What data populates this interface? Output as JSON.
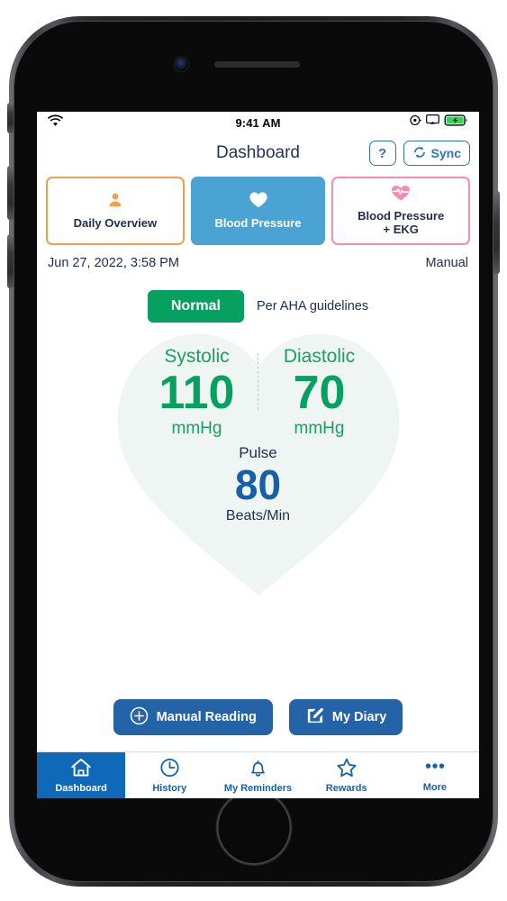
{
  "status_bar": {
    "time": "9:41 AM",
    "wifi_icon": "wifi-icon",
    "location_icon": "location-icon",
    "airplay_icon": "screen-mirroring-icon",
    "battery_icon": "battery-charging-icon"
  },
  "header": {
    "title": "Dashboard",
    "help_label": "?",
    "sync_label": "Sync"
  },
  "tabs": [
    {
      "id": "daily-overview",
      "label": "Daily Overview",
      "icon": "person-icon",
      "color": "#f0a04b",
      "active": false
    },
    {
      "id": "blood-pressure",
      "label": "Blood Pressure",
      "icon": "heart-icon",
      "color": "#4ba3d3",
      "active": true
    },
    {
      "id": "bp-ekg",
      "label": "Blood Pressure\n+ EKG",
      "label_line1": "Blood Pressure",
      "label_line2": "+ EKG",
      "icon": "heart-ekg-icon",
      "color": "#f28cb4",
      "active": false
    }
  ],
  "reading": {
    "datetime": "Jun 27, 2022, 3:58 PM",
    "source": "Manual",
    "status_badge": "Normal",
    "status_color": "#06a160",
    "guideline_note": "Per AHA guidelines",
    "systolic": {
      "label": "Systolic",
      "value": "110",
      "unit": "mmHg"
    },
    "diastolic": {
      "label": "Diastolic",
      "value": "70",
      "unit": "mmHg"
    },
    "pulse": {
      "label": "Pulse",
      "value": "80",
      "unit": "Beats/Min"
    },
    "value_color": "#06a160",
    "pulse_color": "#1660a8"
  },
  "actions": [
    {
      "id": "manual-reading",
      "label": "Manual Reading",
      "icon": "plus-circle-icon"
    },
    {
      "id": "my-diary",
      "label": "My Diary",
      "icon": "pencil-edit-icon"
    }
  ],
  "bottom_nav": [
    {
      "id": "dashboard",
      "label": "Dashboard",
      "icon": "home-icon",
      "active": true
    },
    {
      "id": "history",
      "label": "History",
      "icon": "clock-icon",
      "active": false
    },
    {
      "id": "reminders",
      "label": "My Reminders",
      "icon": "bell-icon",
      "active": false
    },
    {
      "id": "rewards",
      "label": "Rewards",
      "icon": "star-icon",
      "active": false
    },
    {
      "id": "more",
      "label": "More",
      "icon": "ellipsis-icon",
      "active": false
    }
  ]
}
